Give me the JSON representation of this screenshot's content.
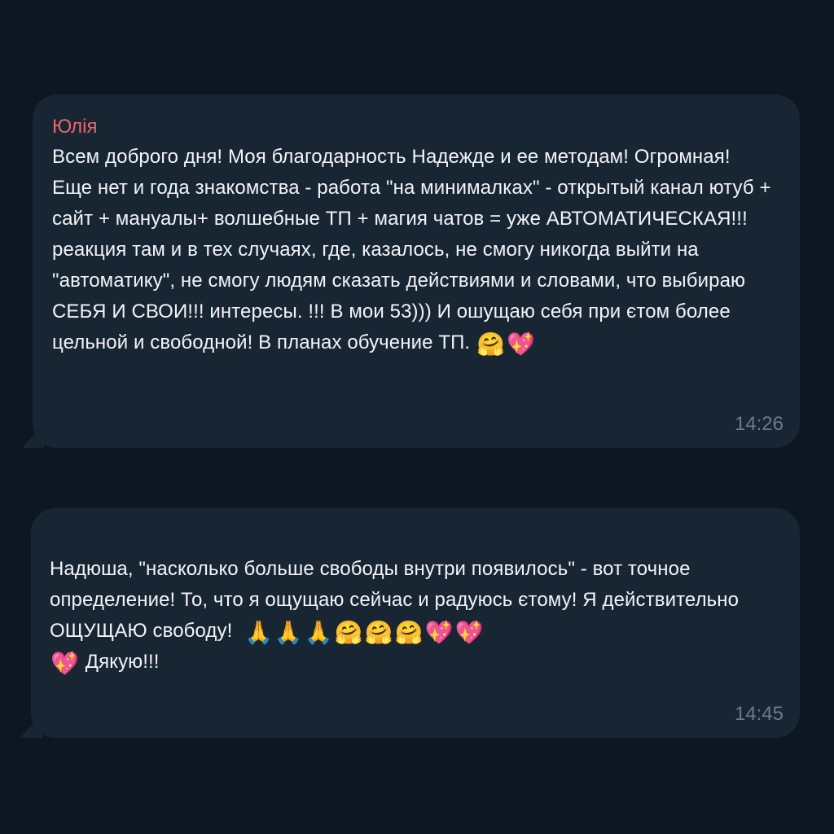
{
  "messages": [
    {
      "sender": "Юлія",
      "text": "Всем доброго дня! Моя благодарность Надежде и ее методам! Огромная! Еще нет и года знакомства - работа \"на минималках\" - открытый канал ютуб + сайт + мануалы+ волшебные ТП + магия чатов = уже АВТОМАТИЧЕСКАЯ!!! реакция там и в тех случаях, где, казалось, не смогу никогда выйти на \"автоматику\", не смогу людям сказать действиями и словами, что выбираю СЕБЯ И СВОИ!!! интересы. !!! В мои 53))) И ошущаю себя при єтом более цельной и свободной! В планах обучение ТП.",
      "emojis": [
        "🤗",
        "💖"
      ],
      "time": "14:26"
    },
    {
      "text_line1": "Надюша, \"насколько больше свободы внутри появилось\" - вот точное определение! То, что я ощущаю сейчас и радуюсь єтому! Я действительно ОЩУЩАЮ свободу!",
      "emojis": [
        "🙏",
        "🙏",
        "🙏",
        "🤗",
        "🤗",
        "🤗",
        "💖",
        "💖",
        "💖"
      ],
      "text_line2": "Дякую!!!",
      "time": "14:45"
    }
  ]
}
